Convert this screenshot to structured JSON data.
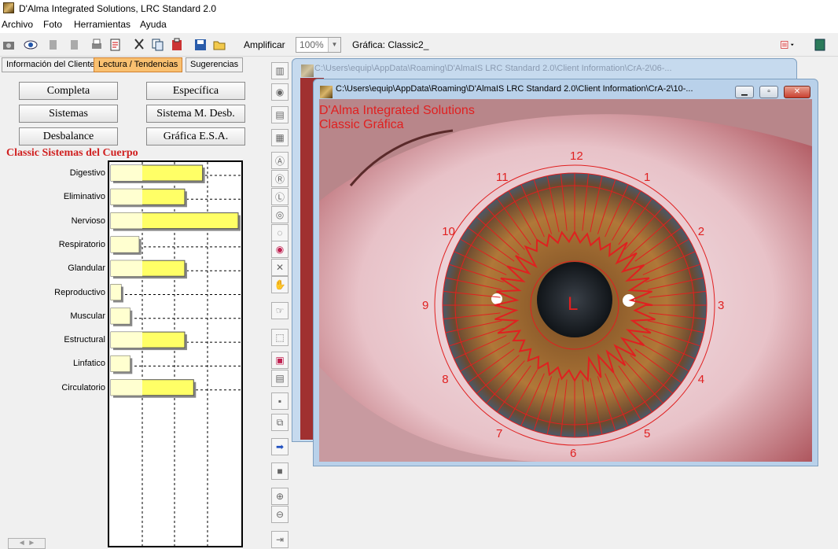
{
  "app": {
    "title": "D'Alma Integrated Solutions, LRC Standard 2.0"
  },
  "menu": [
    "Archivo",
    "Foto",
    "Herramientas",
    "Ayuda"
  ],
  "toolbar": {
    "zoom_label": "Amplificar",
    "zoom_value": "100%",
    "chart_label": "Gráfica: Classic2_"
  },
  "tabs": [
    "Información del Cliente",
    "Lectura / Tendencias",
    "Sugerencias"
  ],
  "buttons": {
    "completa": "Completa",
    "especifica": "Específica",
    "sistemas": "Sistemas",
    "sistema_m": "Sistema M. Desb.",
    "desbalance": "Desbalance",
    "grafica_esa": "Gráfica E.S.A."
  },
  "chart_data": {
    "type": "bar",
    "title": "Classic Sistemas del Cuerpo",
    "categories": [
      "Digestivo",
      "Eliminativo",
      "Nervioso",
      "Respiratorio",
      "Glandular",
      "Reproductivo",
      "Muscular",
      "Estructural",
      "Linfatico",
      "Circulatorio"
    ],
    "values": [
      0.72,
      0.58,
      1.0,
      0.22,
      0.58,
      0.08,
      0.15,
      0.58,
      0.15,
      0.65
    ],
    "grid": true
  },
  "window_back": {
    "title": "C:\\Users\\equip\\AppData\\Roaming\\D'AlmaIS LRC Standard 2.0\\Client Information\\CrA-2\\06-..."
  },
  "window_front": {
    "title": "C:\\Users\\equip\\AppData\\Roaming\\D'AlmaIS LRC Standard 2.0\\Client Information\\CrA-2\\10-...",
    "watermark1": "D'Alma Integrated Solutions",
    "watermark2": "Classic Gráfica",
    "eye_side": "L",
    "clock_numbers": [
      "12",
      "1",
      "2",
      "3",
      "4",
      "5",
      "6",
      "7",
      "8",
      "9",
      "10",
      "11"
    ]
  },
  "colors": {
    "overlay": "#e02020",
    "chart_title": "#d02020",
    "bar": "#ffff66"
  }
}
